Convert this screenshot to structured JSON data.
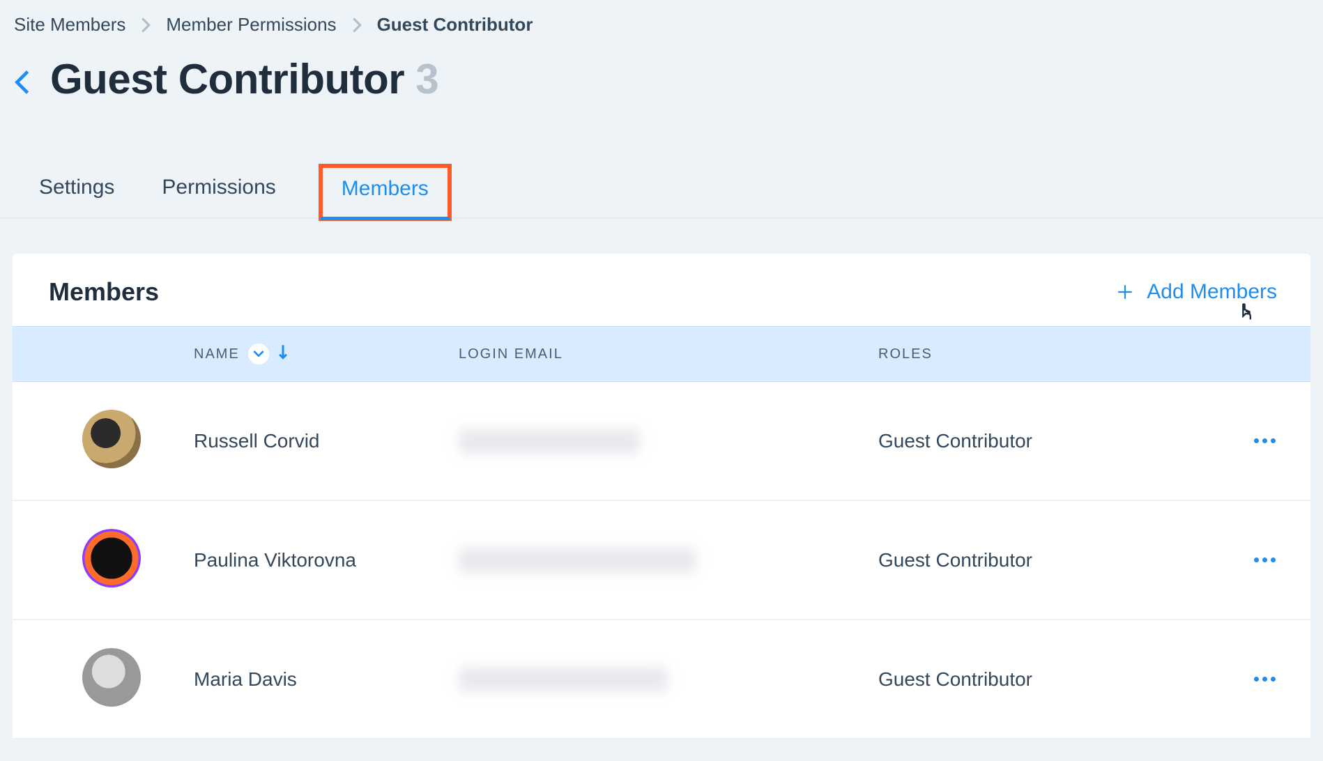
{
  "breadcrumb": {
    "items": [
      "Site Members",
      "Member Permissions",
      "Guest Contributor"
    ]
  },
  "header": {
    "title": "Guest Contributor",
    "count": "3"
  },
  "tabs": [
    {
      "label": "Settings",
      "active": false
    },
    {
      "label": "Permissions",
      "active": false
    },
    {
      "label": "Members",
      "active": true,
      "highlighted": true
    }
  ],
  "panel": {
    "title": "Members",
    "add_label": "Add Members"
  },
  "table": {
    "columns": {
      "name": "NAME",
      "email": "LOGIN EMAIL",
      "roles": "ROLES"
    },
    "rows": [
      {
        "name": "Russell Corvid",
        "role": "Guest Contributor"
      },
      {
        "name": "Paulina Viktorovna",
        "role": "Guest Contributor"
      },
      {
        "name": "Maria Davis",
        "role": "Guest Contributor"
      }
    ]
  }
}
